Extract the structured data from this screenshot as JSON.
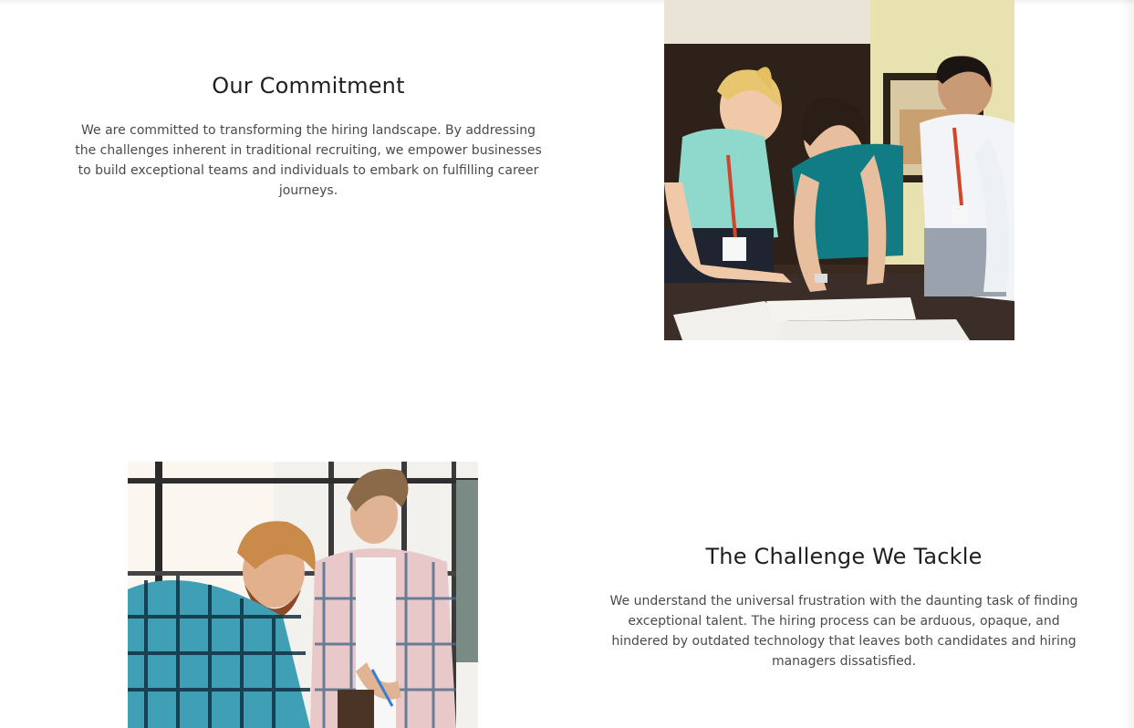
{
  "commitment": {
    "title": "Our Commitment",
    "text": "We are committed to transforming the hiring landscape. By addressing the challenges inherent in traditional recruiting, we empower businesses to build exceptional teams and individuals to embark on fulfilling career journeys."
  },
  "challenge": {
    "title": "The Challenge We Tackle",
    "text": "We understand the universal frustration with the daunting task of finding exceptional talent. The hiring process can be arduous, opaque, and hindered by outdated technology that leaves both candidates and hiring managers dissatisfied."
  },
  "colors": {
    "background": "#ffffff",
    "heading": "#1f1f1f",
    "body_text": "#4a4a4a"
  }
}
